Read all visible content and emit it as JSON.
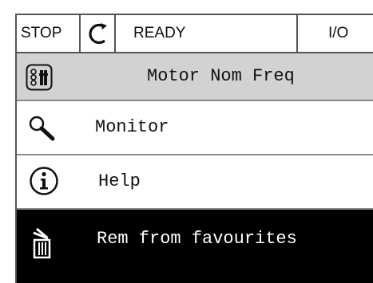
{
  "status_bar": {
    "state": "STOP",
    "run_status": "READY",
    "control_place": "I/O",
    "direction_icon": "rotation-direction-icon"
  },
  "header": {
    "title": "Motor Nom Freq",
    "icon": "parameter-edit-icon"
  },
  "menu": {
    "items": [
      {
        "label": "Monitor",
        "icon": "search-icon"
      },
      {
        "label": "Help",
        "icon": "info-icon"
      },
      {
        "label": "Rem from favourites",
        "icon": "trash-icon",
        "selected": true
      }
    ]
  },
  "colors": {
    "header_bg": "#d2d2d2",
    "selected_bg": "#000000",
    "selected_text": "#ffffff"
  }
}
